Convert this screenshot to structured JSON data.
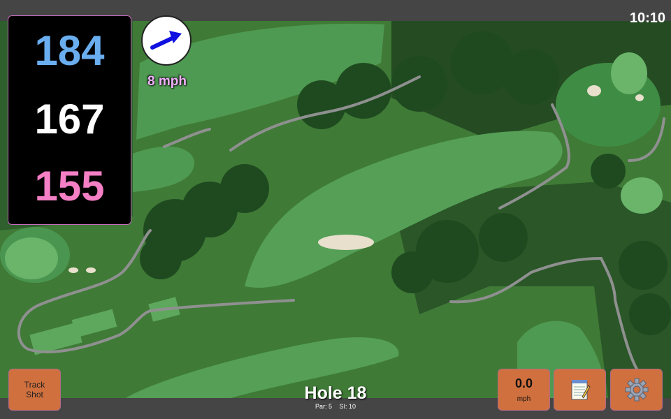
{
  "clock": "10:10",
  "distances": {
    "back": "184",
    "middle": "167",
    "front": "155",
    "colors": {
      "back": "#6aaef0",
      "middle": "#ffffff",
      "front": "#f47fc5"
    }
  },
  "wind": {
    "speed_label": "8 mph",
    "icon": "wind-arrow-icon",
    "arrow_color": "#1010e0",
    "label_color": "#f3b0ff"
  },
  "buttons": {
    "track_shot_line1": "Track",
    "track_shot_line2": "Shot",
    "speed_value": "0.0",
    "speed_unit": "mph",
    "notes_icon": "notepad-icon",
    "settings_icon": "gear-icon",
    "accent": "#d0703e"
  },
  "hole": {
    "title": "Hole 18",
    "par": "Par: 5",
    "si": "SI: 10"
  },
  "map": {
    "fairway_color": "#4f9a52",
    "rough_color": "#3f7a36",
    "trees_color": "#1f4a20",
    "path_color": "#8f9090",
    "sand_color": "#e8e0cc"
  }
}
